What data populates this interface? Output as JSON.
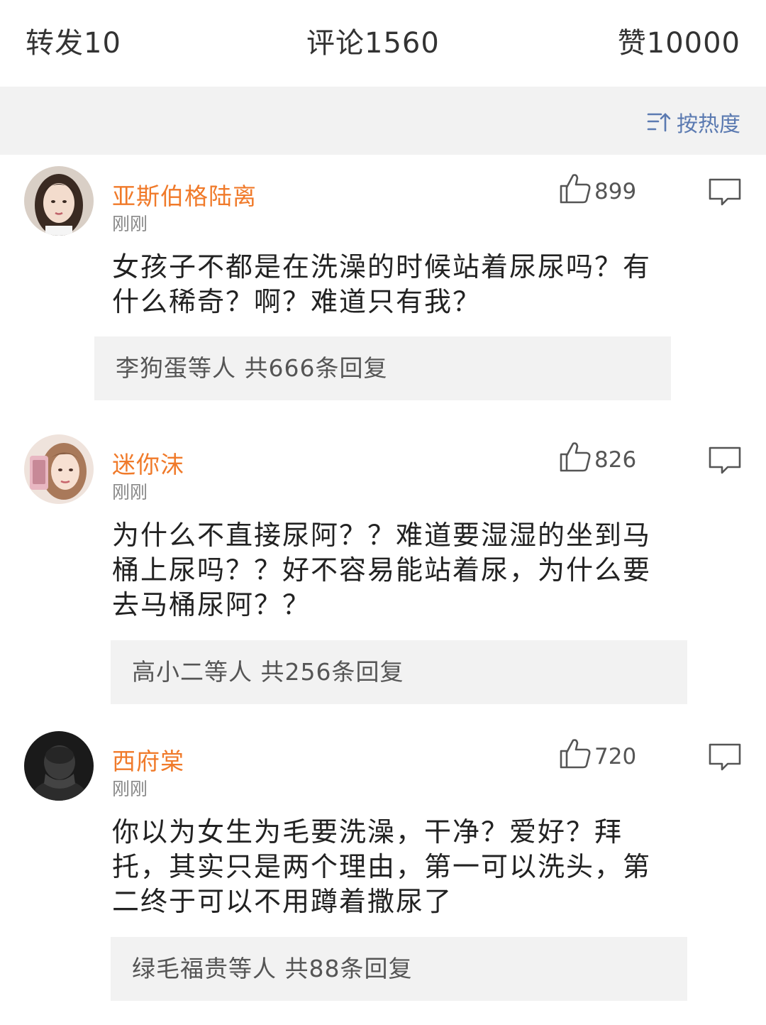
{
  "tabs": {
    "repost": "转发10",
    "comments": "评论1560",
    "likes": "赞10000"
  },
  "sort": {
    "icon": "sort-icon",
    "label": "按热度"
  },
  "colors": {
    "username": "#f07a2a",
    "sort": "#5b7ab1",
    "panel": "#f2f2f2"
  },
  "comments": [
    {
      "username": "亚斯伯格陆离",
      "time": "刚刚",
      "likes": "899",
      "text": "女孩子不都是在洗澡的时候站着尿尿吗？有什么稀奇？啊？难道只有我？",
      "replies": "李狗蛋等人 共666条回复"
    },
    {
      "username": "迷你沫",
      "time": "刚刚",
      "likes": "826",
      "text": "为什么不直接尿阿？？难道要湿湿的坐到马桶上尿吗？？好不容易能站着尿，为什么要去马桶尿阿？？",
      "replies": "高小二等人 共256条回复"
    },
    {
      "username": "西府棠",
      "time": "刚刚",
      "likes": "720",
      "text": "你以为女生为毛要洗澡，干净？爱好？拜托，其实只是两个理由，第一可以洗头，第二终于可以不用蹲着撒尿了",
      "replies": "绿毛福贵等人 共88条回复"
    }
  ]
}
